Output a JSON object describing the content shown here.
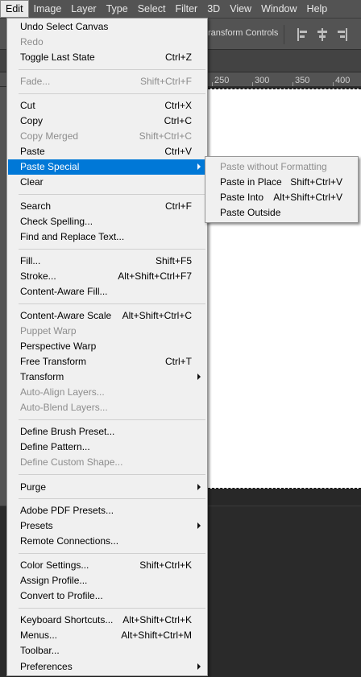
{
  "menubar": [
    {
      "label": "Edit",
      "active": true
    },
    {
      "label": "Image"
    },
    {
      "label": "Layer"
    },
    {
      "label": "Type"
    },
    {
      "label": "Select"
    },
    {
      "label": "Filter"
    },
    {
      "label": "3D"
    },
    {
      "label": "View"
    },
    {
      "label": "Window"
    },
    {
      "label": "Help"
    }
  ],
  "options_bar": {
    "transform_controls": "ransform Controls"
  },
  "ruler": {
    "ticks": [
      "250",
      "300",
      "350",
      "400"
    ]
  },
  "edit_menu": {
    "items": [
      {
        "label": "Undo Select Canvas",
        "shortcut": ""
      },
      {
        "label": "Redo",
        "shortcut": "",
        "disabled": true
      },
      {
        "label": "Toggle Last State",
        "shortcut": "Ctrl+Z"
      },
      {
        "label": "Fade...",
        "shortcut": "Shift+Ctrl+F",
        "disabled": true
      },
      {
        "label": "Cut",
        "shortcut": "Ctrl+X"
      },
      {
        "label": "Copy",
        "shortcut": "Ctrl+C"
      },
      {
        "label": "Copy Merged",
        "shortcut": "Shift+Ctrl+C",
        "disabled": true
      },
      {
        "label": "Paste",
        "shortcut": "Ctrl+V"
      },
      {
        "label": "Paste Special",
        "shortcut": "",
        "submenu": true,
        "highlighted": true
      },
      {
        "label": "Clear",
        "shortcut": ""
      },
      {
        "label": "Search",
        "shortcut": "Ctrl+F"
      },
      {
        "label": "Check Spelling...",
        "shortcut": ""
      },
      {
        "label": "Find and Replace Text...",
        "shortcut": ""
      },
      {
        "label": "Fill...",
        "shortcut": "Shift+F5"
      },
      {
        "label": "Stroke...",
        "shortcut": "Alt+Shift+Ctrl+F7"
      },
      {
        "label": "Content-Aware Fill...",
        "shortcut": ""
      },
      {
        "label": "Content-Aware Scale",
        "shortcut": "Alt+Shift+Ctrl+C"
      },
      {
        "label": "Puppet Warp",
        "shortcut": "",
        "disabled": true
      },
      {
        "label": "Perspective Warp",
        "shortcut": ""
      },
      {
        "label": "Free Transform",
        "shortcut": "Ctrl+T"
      },
      {
        "label": "Transform",
        "shortcut": "",
        "submenu": true
      },
      {
        "label": "Auto-Align Layers...",
        "shortcut": "",
        "disabled": true
      },
      {
        "label": "Auto-Blend Layers...",
        "shortcut": "",
        "disabled": true
      },
      {
        "label": "Define Brush Preset...",
        "shortcut": ""
      },
      {
        "label": "Define Pattern...",
        "shortcut": ""
      },
      {
        "label": "Define Custom Shape...",
        "shortcut": "",
        "disabled": true
      },
      {
        "label": "Purge",
        "shortcut": "",
        "submenu": true
      },
      {
        "label": "Adobe PDF Presets...",
        "shortcut": ""
      },
      {
        "label": "Presets",
        "shortcut": "",
        "submenu": true
      },
      {
        "label": "Remote Connections...",
        "shortcut": ""
      },
      {
        "label": "Color Settings...",
        "shortcut": "Shift+Ctrl+K"
      },
      {
        "label": "Assign Profile...",
        "shortcut": ""
      },
      {
        "label": "Convert to Profile...",
        "shortcut": ""
      },
      {
        "label": "Keyboard Shortcuts...",
        "shortcut": "Alt+Shift+Ctrl+K"
      },
      {
        "label": "Menus...",
        "shortcut": "Alt+Shift+Ctrl+M"
      },
      {
        "label": "Toolbar...",
        "shortcut": ""
      },
      {
        "label": "Preferences",
        "shortcut": "",
        "submenu": true
      }
    ]
  },
  "paste_special_submenu": {
    "items": [
      {
        "label": "Paste without Formatting",
        "shortcut": "",
        "disabled": true
      },
      {
        "label": "Paste in Place",
        "shortcut": "Shift+Ctrl+V"
      },
      {
        "label": "Paste Into",
        "shortcut": "Alt+Shift+Ctrl+V"
      },
      {
        "label": "Paste Outside",
        "shortcut": ""
      }
    ]
  },
  "colors": {
    "highlight": "#0078d7",
    "menu_bg": "#f0f0f0",
    "disabled_text": "#8d8d8d",
    "chrome": "#535353"
  }
}
